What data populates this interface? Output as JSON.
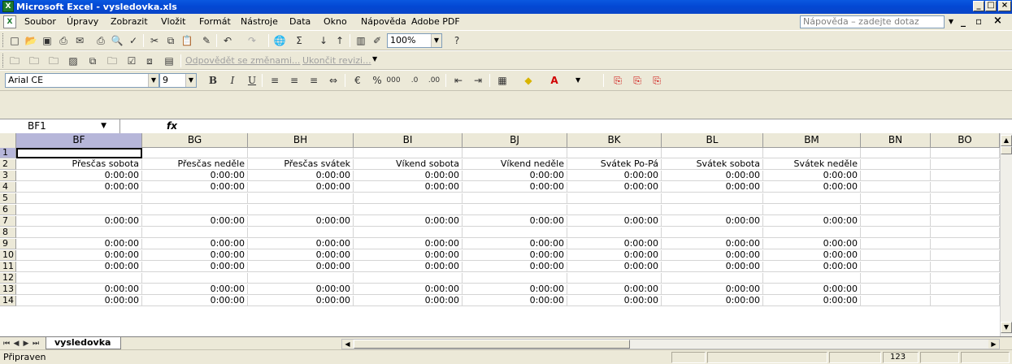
{
  "window": {
    "title": "Microsoft Excel - vysledovka.xls",
    "min_label": "_",
    "max_label": "□",
    "close_label": "×"
  },
  "menu": {
    "items": [
      "Soubor",
      "Úpravy",
      "Zobrazit",
      "Vložit",
      "Formát",
      "Nástroje",
      "Data",
      "Okno",
      "Nápověda",
      "Adobe PDF"
    ],
    "help_placeholder": "Nápověda – zadejte dotaz"
  },
  "toolbar": {
    "zoom": "100%",
    "reply_with_changes": "Odpovědět se změnami...",
    "end_review": "Ukončit revizi...",
    "font_name": "Arial CE",
    "font_size": "9",
    "bold": "B",
    "italic": "I",
    "underline": "U",
    "percent": "%",
    "thousands": "000"
  },
  "formula_bar": {
    "name_box": "BF1",
    "fx_label": "fx",
    "formula": ""
  },
  "sheet": {
    "columns": [
      "BF",
      "BG",
      "BH",
      "BI",
      "BJ",
      "BK",
      "BL",
      "BM",
      "BN",
      "BO"
    ],
    "rows": [
      {
        "n": "1",
        "cells": [
          "",
          "",
          "",
          "",
          "",
          "",
          "",
          "",
          "",
          ""
        ]
      },
      {
        "n": "2",
        "cells": [
          "Přesčas sobota",
          "Přesčas neděle",
          "Přesčas svátek",
          "Víkend sobota",
          "Víkend neděle",
          "Svátek Po-Pá",
          "Svátek sobota",
          "Svátek neděle",
          "",
          ""
        ]
      },
      {
        "n": "3",
        "cells": [
          "0:00:00",
          "0:00:00",
          "0:00:00",
          "0:00:00",
          "0:00:00",
          "0:00:00",
          "0:00:00",
          "0:00:00",
          "",
          ""
        ]
      },
      {
        "n": "4",
        "cells": [
          "0:00:00",
          "0:00:00",
          "0:00:00",
          "0:00:00",
          "0:00:00",
          "0:00:00",
          "0:00:00",
          "0:00:00",
          "",
          ""
        ]
      },
      {
        "n": "5",
        "cells": [
          "",
          "",
          "",
          "",
          "",
          "",
          "",
          "",
          "",
          ""
        ]
      },
      {
        "n": "6",
        "cells": [
          "",
          "",
          "",
          "",
          "",
          "",
          "",
          "",
          "",
          ""
        ]
      },
      {
        "n": "7",
        "cells": [
          "0:00:00",
          "0:00:00",
          "0:00:00",
          "0:00:00",
          "0:00:00",
          "0:00:00",
          "0:00:00",
          "0:00:00",
          "",
          ""
        ]
      },
      {
        "n": "8",
        "cells": [
          "",
          "",
          "",
          "",
          "",
          "",
          "",
          "",
          "",
          ""
        ]
      },
      {
        "n": "9",
        "cells": [
          "0:00:00",
          "0:00:00",
          "0:00:00",
          "0:00:00",
          "0:00:00",
          "0:00:00",
          "0:00:00",
          "0:00:00",
          "",
          ""
        ]
      },
      {
        "n": "10",
        "cells": [
          "0:00:00",
          "0:00:00",
          "0:00:00",
          "0:00:00",
          "0:00:00",
          "0:00:00",
          "0:00:00",
          "0:00:00",
          "",
          ""
        ]
      },
      {
        "n": "11",
        "cells": [
          "0:00:00",
          "0:00:00",
          "0:00:00",
          "0:00:00",
          "0:00:00",
          "0:00:00",
          "0:00:00",
          "0:00:00",
          "",
          ""
        ]
      },
      {
        "n": "12",
        "cells": [
          "",
          "",
          "",
          "",
          "",
          "",
          "",
          "",
          "",
          ""
        ]
      },
      {
        "n": "13",
        "cells": [
          "0:00:00",
          "0:00:00",
          "0:00:00",
          "0:00:00",
          "0:00:00",
          "0:00:00",
          "0:00:00",
          "0:00:00",
          "",
          ""
        ]
      },
      {
        "n": "14",
        "cells": [
          "0:00:00",
          "0:00:00",
          "0:00:00",
          "0:00:00",
          "0:00:00",
          "0:00:00",
          "0:00:00",
          "0:00:00",
          "",
          ""
        ]
      }
    ],
    "tab_name": "vysledovka"
  },
  "status": {
    "text": "Připraven",
    "num_indicator": "123"
  }
}
